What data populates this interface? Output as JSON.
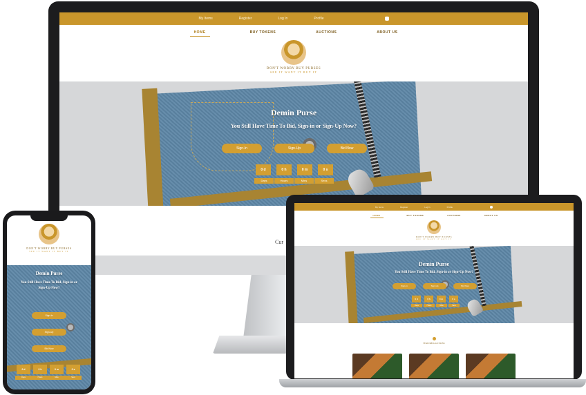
{
  "site": {
    "topbar": {
      "links": [
        "My Items",
        "Register",
        "Log In",
        "Profile"
      ],
      "cart_icon": "cart-icon"
    },
    "nav": {
      "items": [
        "HOME",
        "BUY TOKENS",
        "AUCTIONS",
        "ABOUT US"
      ],
      "active": "HOME"
    },
    "brand": {
      "name": "DON'T WORRY BUY PURSES",
      "tagline": "SEE IT WANT IT BUY IT",
      "logo_icon": "woman-portrait-logo-icon"
    },
    "hero": {
      "title": "Demin Purse",
      "subtitle": "You Still Have Time To Bid, Sign-in or Sign-Up Now?",
      "buttons": [
        "Sign-In",
        "Sign-Up",
        "Bid Now"
      ],
      "countdown_values": [
        "0 d",
        "0 h",
        "0 m",
        "0 s"
      ],
      "countdown_labels": [
        "Days",
        "Hours",
        "Mins",
        "Secs"
      ]
    },
    "below_hero_text": "Cur",
    "laptop_section_label": "FEATURED AUCTIONS",
    "colors": {
      "accent": "#c9962b",
      "button": "#d39f31",
      "hero_bg": "#d6d7d9",
      "denim": "#5e87a7"
    }
  }
}
